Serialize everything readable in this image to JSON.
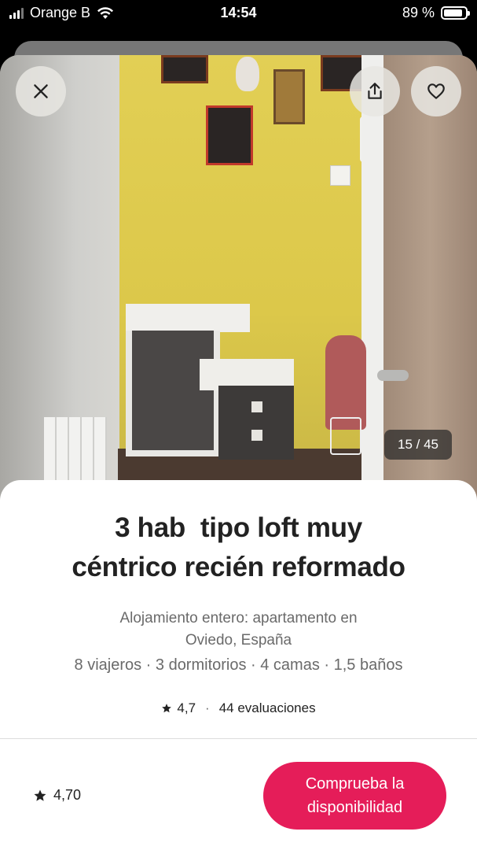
{
  "status_bar": {
    "carrier": "Orange B",
    "time": "14:54",
    "battery_percent": "89 %",
    "battery_level": 0.89
  },
  "photo": {
    "counter": "15 / 45"
  },
  "listing": {
    "title_line1": "3 hab  tipo loft muy",
    "title_line2": "céntrico recién reformado",
    "subtitle_line1": "Alojamiento entero: apartamento en",
    "subtitle_line2": "Oviedo, España",
    "details": "8 viajeros · 3 dormitorios · 4 camas · 1,5 baños",
    "rating": "4,7",
    "separator": "·",
    "reviews": "44 evaluaciones"
  },
  "footer": {
    "rating": "4,70",
    "cta_label": "Comprueba la disponibilidad",
    "cta_color": "#e51d59"
  },
  "icons": [
    "close-icon",
    "share-icon",
    "heart-icon",
    "star-icon",
    "wifi-icon",
    "battery-icon",
    "signal-icon"
  ]
}
